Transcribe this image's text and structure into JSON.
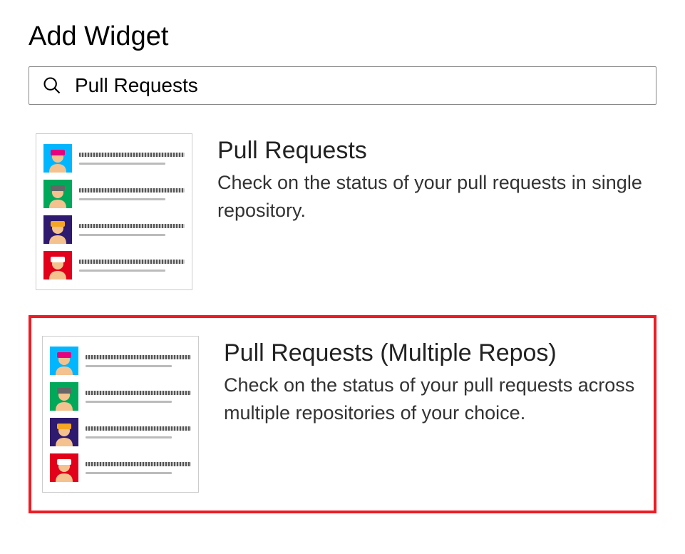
{
  "header": {
    "title": "Add Widget"
  },
  "search": {
    "value": "Pull Requests"
  },
  "widgets": [
    {
      "title": "Pull Requests",
      "description": "Check on the status of your pull requests in single repository.",
      "highlighted": false
    },
    {
      "title": "Pull Requests (Multiple Repos)",
      "description": "Check on the status of your pull requests across multiple repositories of your choice.",
      "highlighted": true
    }
  ],
  "thumb_avatars": [
    {
      "bg": "#00b7ff",
      "hat": "#e6007e"
    },
    {
      "bg": "#00a859",
      "hat": "#666"
    },
    {
      "bg": "#2e1a6e",
      "hat": "#f5a623"
    },
    {
      "bg": "#e2001a",
      "hat": "#fff"
    }
  ]
}
